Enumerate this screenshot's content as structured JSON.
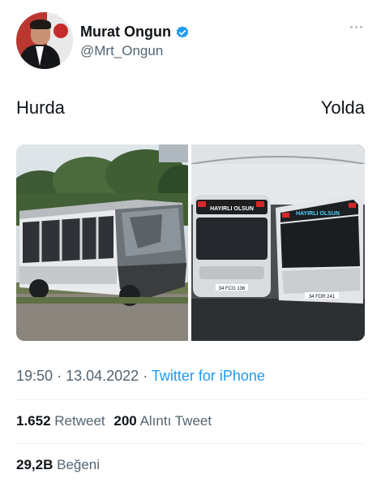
{
  "tweet": {
    "author": {
      "display_name": "Murat Ongun",
      "handle": "@Mrt_Ongun",
      "verified": true
    },
    "captions": {
      "left": "Hurda",
      "right": "Yolda"
    },
    "media": {
      "left_photo": {
        "description_icon": "wrecked-bus-photo"
      },
      "right_photo": {
        "description_icon": "new-buses-photo",
        "sign_text_1": "HAYIRLI OLSUN",
        "sign_text_2": "HAYIRLI OLSUN",
        "plate_1": "34 FCG 136",
        "plate_2": "34 FDR 241"
      }
    },
    "meta": {
      "time": "19:50",
      "separator": "·",
      "date": "13.04.2022",
      "source": "Twitter for iPhone"
    },
    "stats": {
      "retweets_count": "1.652",
      "retweets_label": "Retweet",
      "quotes_count": "200",
      "quotes_label": "Alıntı Tweet",
      "likes_count": "29,2B",
      "likes_label": "Beğeni"
    }
  },
  "colors": {
    "text": "#0f1419",
    "secondary": "#536471",
    "link": "#1d9bf0",
    "divider": "#eff3f4",
    "verified": "#1d9bf0"
  }
}
